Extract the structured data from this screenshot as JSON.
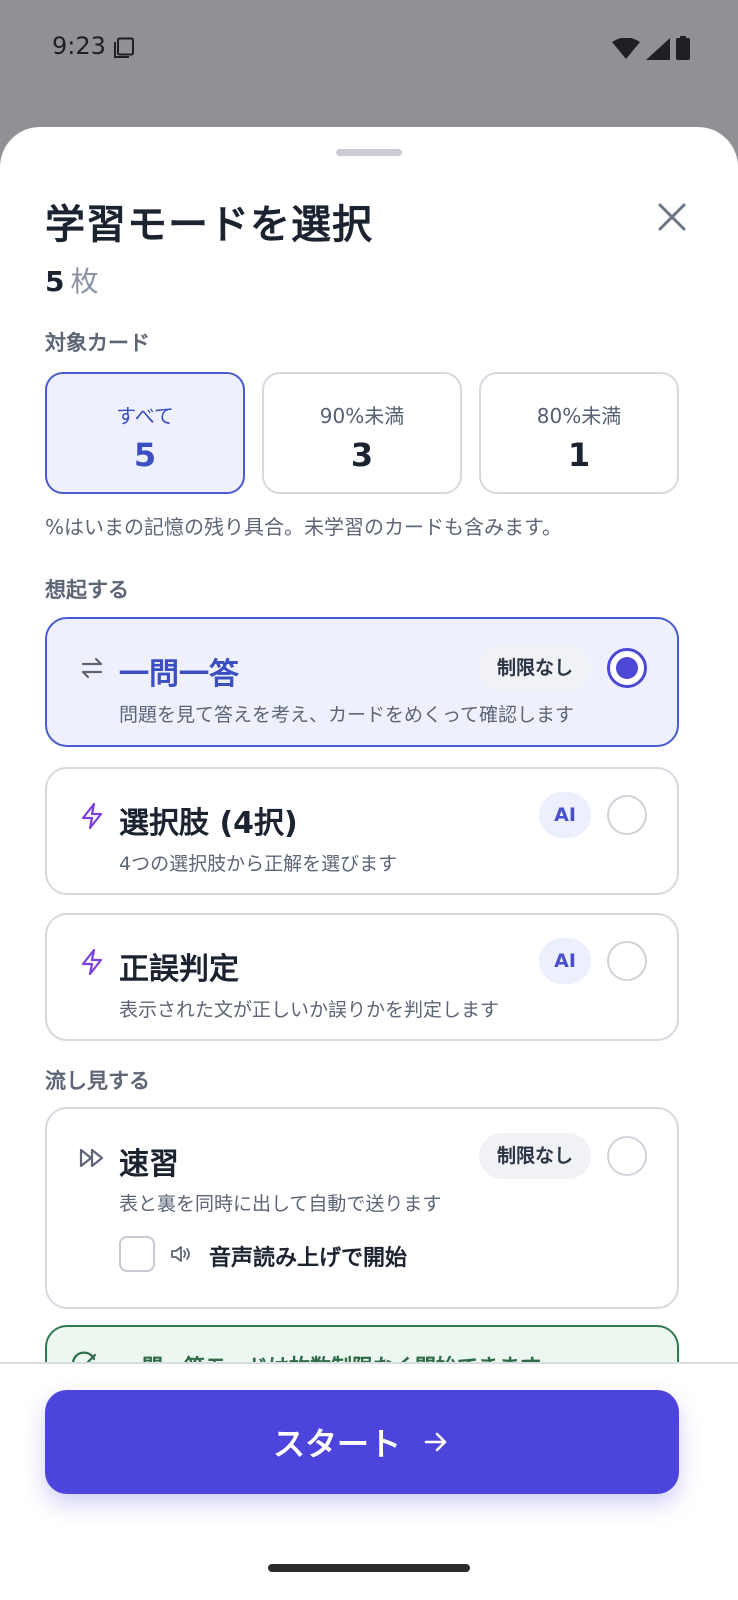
{
  "status_bar": {
    "time": "9:23"
  },
  "sheet": {
    "title": "学習モードを選択",
    "count_value": "5",
    "count_unit": "枚"
  },
  "target": {
    "label": "対象カード",
    "options": [
      {
        "label": "すべて",
        "count": "5",
        "selected": true
      },
      {
        "label": "90%未満",
        "count": "3",
        "selected": false
      },
      {
        "label": "80%未満",
        "count": "1",
        "selected": false
      }
    ],
    "help": "%はいまの記憶の残り具合。未学習のカードも含みます。"
  },
  "recall": {
    "label": "想起する",
    "modes": [
      {
        "title": "一問一答",
        "desc": "問題を見て答えを考え、カードをめくって確認します",
        "badge": "制限なし",
        "icon": "repeat-icon",
        "selected": true
      },
      {
        "title": "選択肢 (4択)",
        "desc": "4つの選択肢から正解を選びます",
        "badge": "AI",
        "icon": "lightning-icon",
        "selected": false
      },
      {
        "title": "正誤判定",
        "desc": "表示された文が正しいか誤りかを判定します",
        "badge": "AI",
        "icon": "lightning-icon",
        "selected": false
      }
    ]
  },
  "browse": {
    "label": "流し見する",
    "mode": {
      "title": "速習",
      "desc": "表と裏を同時に出して自動で送ります",
      "badge": "制限なし",
      "icon": "fast-forward-icon",
      "selected": false,
      "tts_label": "音声読み上げで開始"
    }
  },
  "info_banner": {
    "text": "一問一答モードは枚数制限なく開始できます",
    "color": "#2e6b46"
  },
  "footer": {
    "start_label": "スタート",
    "accent": "#4c44dc"
  }
}
